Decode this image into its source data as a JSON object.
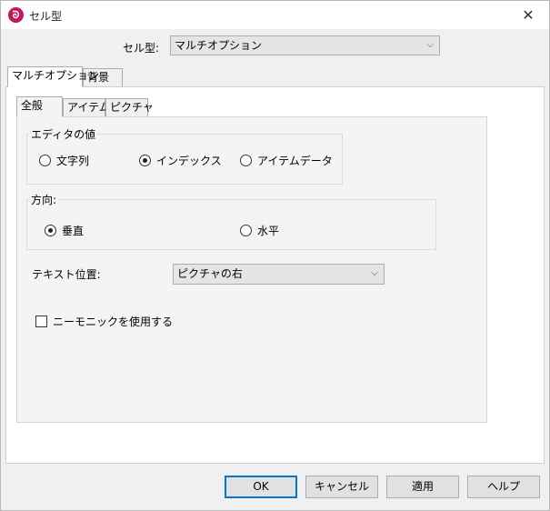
{
  "window": {
    "title": "セル型",
    "app_icon_glyph": "ᘐ",
    "close_glyph": "✕"
  },
  "celltype": {
    "label": "セル型:",
    "value": "マルチオプション"
  },
  "outer_tabs": [
    {
      "label": "マルチオプション",
      "active": true
    },
    {
      "label": "背景",
      "active": false
    }
  ],
  "inner_tabs": [
    {
      "label": "全般",
      "active": true
    },
    {
      "label": "アイテム",
      "active": false
    },
    {
      "label": "ピクチャ",
      "active": false
    }
  ],
  "editor_value_group": {
    "title": "エディタの値",
    "options": [
      {
        "label": "文字列",
        "checked": false
      },
      {
        "label": "インデックス",
        "checked": true
      },
      {
        "label": "アイテムデータ",
        "checked": false
      }
    ]
  },
  "direction_group": {
    "title": "方向:",
    "options": [
      {
        "label": "垂直",
        "checked": true
      },
      {
        "label": "水平",
        "checked": false
      }
    ]
  },
  "text_position": {
    "label": "テキスト位置:",
    "value": "ピクチャの右"
  },
  "mnemonic": {
    "label": "ニーモニックを使用する",
    "checked": false
  },
  "buttons": {
    "ok": "OK",
    "cancel": "キャンセル",
    "apply": "適用",
    "help": "ヘルプ"
  },
  "colors": {
    "accent": "#0078d7",
    "app_icon": "#c2185b",
    "dialog_bg": "#f0f0f0"
  }
}
